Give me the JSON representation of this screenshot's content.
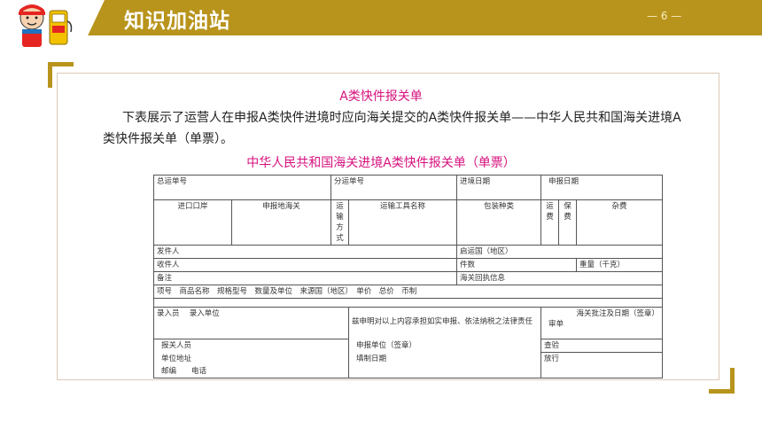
{
  "header": {
    "title": "知识加油站",
    "page": "— 6 —"
  },
  "doc_title": "A类快件报关单",
  "intro": "下表展示了运营人在申报A类快件进境时应向海关提交的A类快件报关单——中华人民共和国海关进境A类快件报关单（单票）。",
  "form": {
    "title": "中华人民共和国海关进境A类快件报关单（单票）",
    "master_waybill": "总运单号",
    "sub_waybill": "分运单号",
    "entry_date": "进境日期",
    "declare_date": "申报日期",
    "entry_port": "进口口岸",
    "declare_customs": "申报地海关",
    "transport_mode": "运输方式",
    "transport_name": "运输工具名称",
    "package_type": "包装种类",
    "freight": "运费",
    "insurance": "保费",
    "misc_fee": "杂费",
    "sender": "发件人",
    "origin_country": "启运国（地区）",
    "receiver": "收件人",
    "pieces": "件数",
    "weight": "重量（千克）",
    "remarks": "备注",
    "customs_receipt": "海关回执信息",
    "item_columns": "项号　商品名称　规格型号　数量及单位　来源国（地区）　单价　总价　币制",
    "entry_clerk": "录入员　 录入单位",
    "declaration_statement": "兹申明对以上内容承担如实申报、依法纳税之法律责任",
    "approval": "海关批注及日期（签章）",
    "review": "审单",
    "declarant": "报关人员",
    "declare_unit": "申报单位（签章）",
    "inspection": "查验",
    "unit_address": "单位地址",
    "fill_date": "填制日期",
    "release": "放行",
    "postcode_phone": "邮编　　电话"
  },
  "colors": {
    "accent": "#b8941c",
    "title_pink": "#d6127e"
  }
}
